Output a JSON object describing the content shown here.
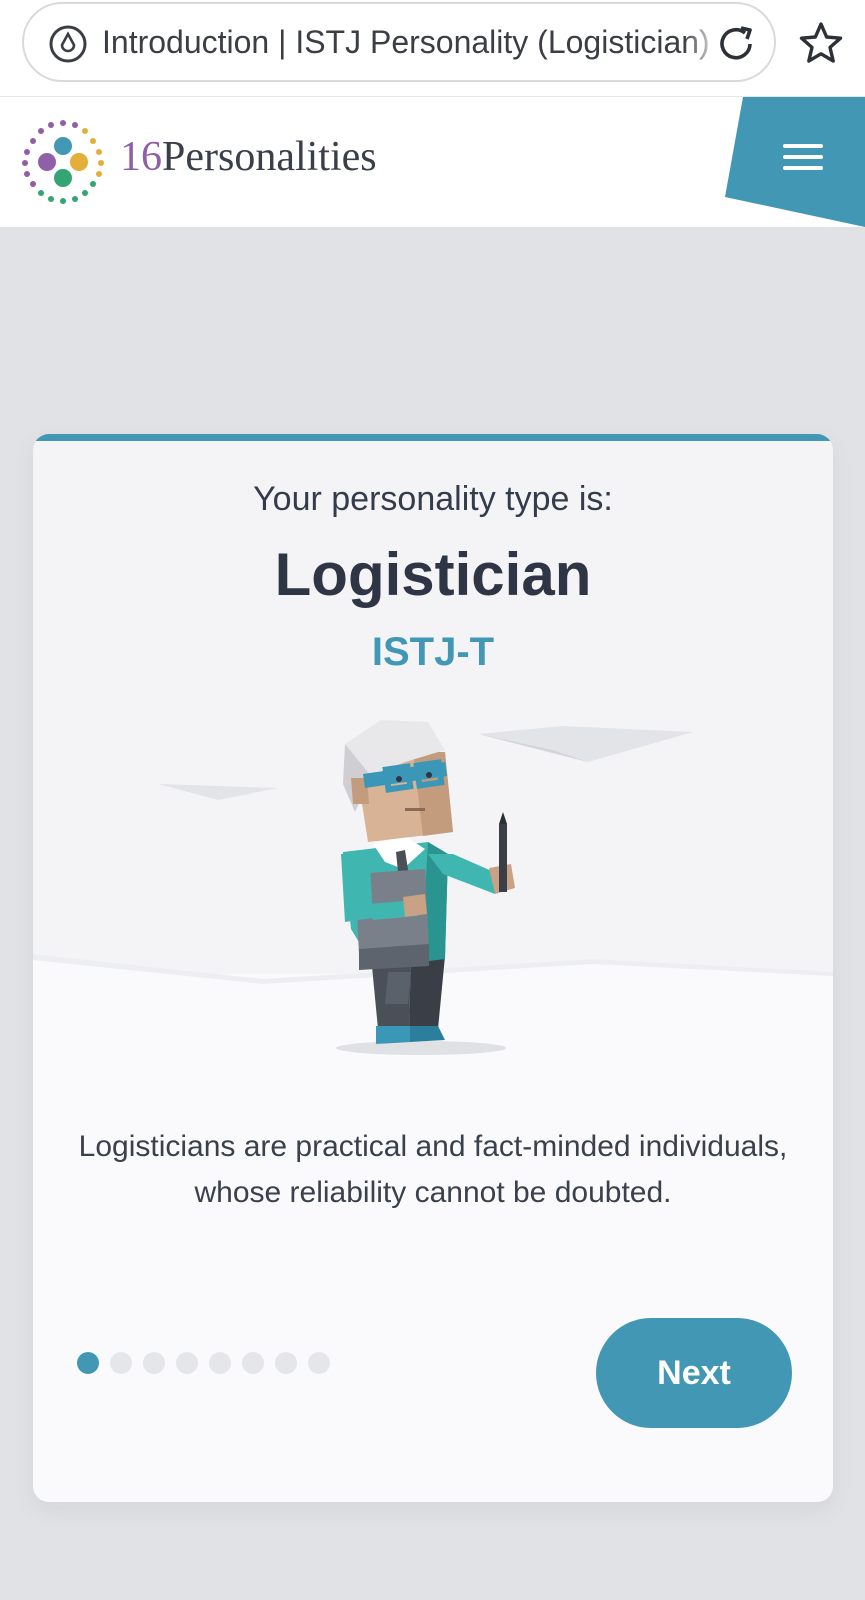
{
  "browser": {
    "tab_title": "Introduction | ISTJ Personality (Logistician)",
    "icons": {
      "site": "site-info-icon",
      "reload": "reload-icon",
      "bookmark": "star-icon"
    }
  },
  "site": {
    "logo_number": "16",
    "logo_name": "Personalities",
    "menu_icon": "hamburger-menu-icon",
    "accent_color": "#4298b4"
  },
  "result": {
    "subtitle": "Your personality type is:",
    "type_name": "Logistician",
    "type_code": "ISTJ-T",
    "description": "Logisticians are practical and fact-minded individuals, whose reliability cannot be doubted.",
    "illustration": "logistician-character-illustration"
  },
  "pager": {
    "total": 8,
    "current": 1,
    "next_label": "Next"
  }
}
